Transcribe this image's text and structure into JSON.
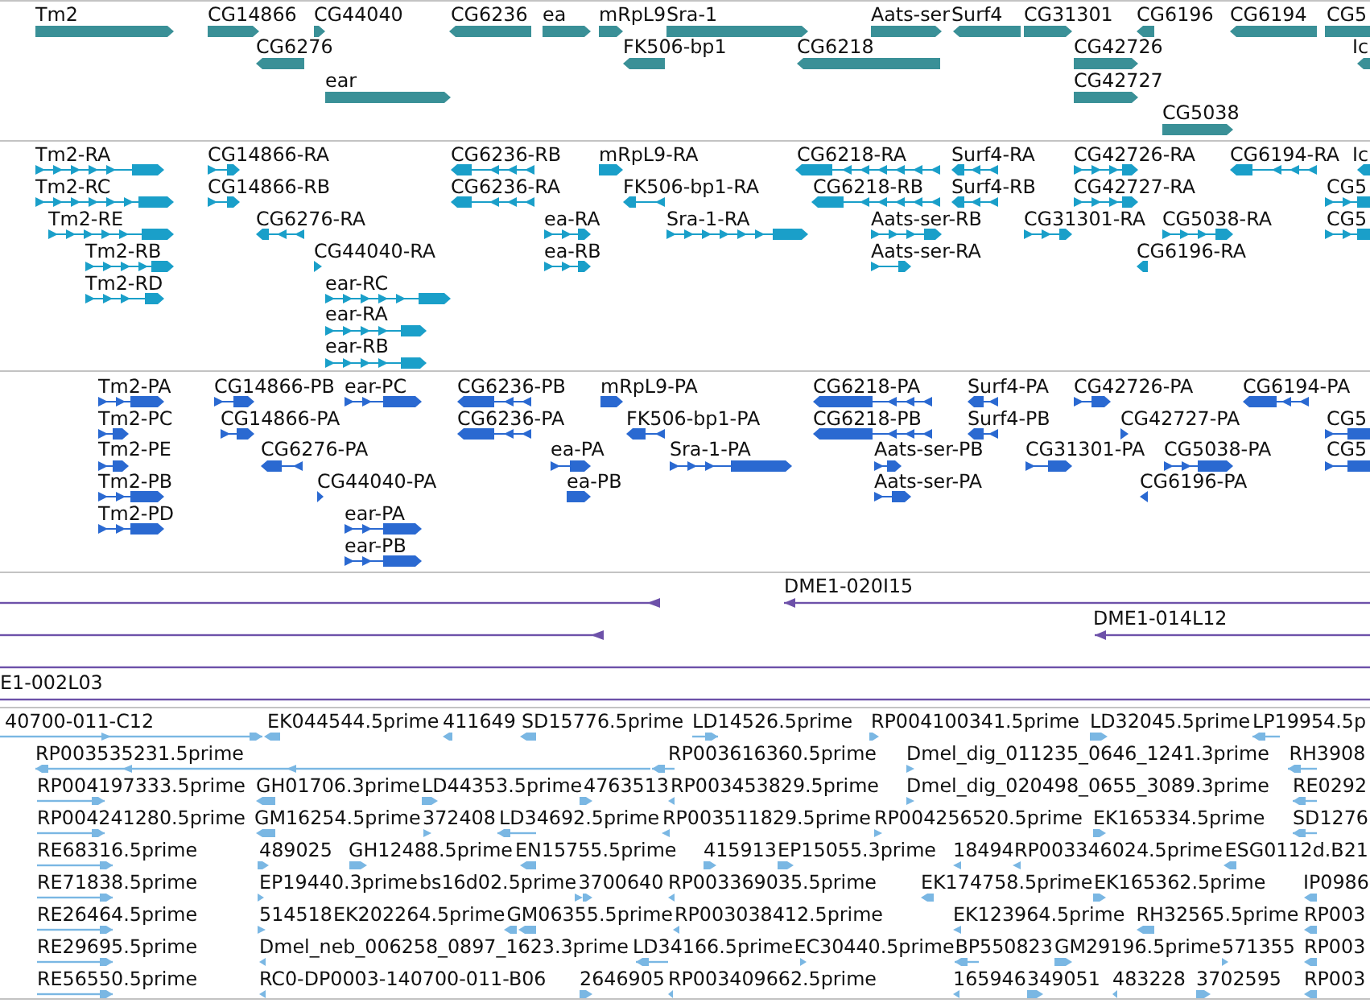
{
  "tracks": [
    {
      "kind": "gene",
      "features": [
        {
          "label": "Tm2",
          "reverse": false
        },
        {
          "label": "CG14866",
          "reverse": false
        },
        {
          "label": "CG44040",
          "reverse": false
        },
        {
          "label": "CG6236",
          "reverse": true
        },
        {
          "label": "ea",
          "reverse": false
        },
        {
          "label": "mRpL9",
          "reverse": false
        },
        {
          "label": "Sra-1",
          "reverse": false
        },
        {
          "label": "Aats-ser",
          "reverse": false
        },
        {
          "label": "Surf4",
          "reverse": true
        },
        {
          "label": "CG31301",
          "reverse": false
        },
        {
          "label": "CG6196",
          "reverse": true
        },
        {
          "label": "CG6194",
          "reverse": true
        },
        {
          "label": "CG5",
          "reverse": false
        },
        {
          "label": "CG6276",
          "reverse": true
        },
        {
          "label": "FK506-bp1",
          "reverse": true
        },
        {
          "label": "CG6218",
          "reverse": true
        },
        {
          "label": "CG42726",
          "reverse": false
        },
        {
          "label": "Ic",
          "reverse": true
        },
        {
          "label": "ear",
          "reverse": false
        },
        {
          "label": "CG42727",
          "reverse": false
        },
        {
          "label": "CG5038",
          "reverse": false
        }
      ]
    },
    {
      "kind": "transcript",
      "features": [
        {
          "label": "Tm2-RA",
          "reverse": false
        },
        {
          "label": "CG14866-RA",
          "reverse": false
        },
        {
          "label": "CG6236-RB",
          "reverse": true
        },
        {
          "label": "mRpL9-RA",
          "reverse": false
        },
        {
          "label": "CG6218-RA",
          "reverse": true
        },
        {
          "label": "Surf4-RA",
          "reverse": true
        },
        {
          "label": "CG42726-RA",
          "reverse": false
        },
        {
          "label": "CG6194-RA",
          "reverse": true
        },
        {
          "label": "Ic",
          "reverse": true
        },
        {
          "label": "Tm2-RC",
          "reverse": false
        },
        {
          "label": "CG14866-RB",
          "reverse": false
        },
        {
          "label": "CG6236-RA",
          "reverse": true
        },
        {
          "label": "FK506-bp1-RA",
          "reverse": true
        },
        {
          "label": "CG6218-RB",
          "reverse": true
        },
        {
          "label": "Surf4-RB",
          "reverse": true
        },
        {
          "label": "CG42727-RA",
          "reverse": false
        },
        {
          "label": "CG5",
          "reverse": false
        },
        {
          "label": "Tm2-RE",
          "reverse": false
        },
        {
          "label": "CG6276-RA",
          "reverse": true
        },
        {
          "label": "ea-RA",
          "reverse": false
        },
        {
          "label": "Sra-1-RA",
          "reverse": false
        },
        {
          "label": "Aats-ser-RB",
          "reverse": false
        },
        {
          "label": "CG31301-RA",
          "reverse": false
        },
        {
          "label": "CG5038-RA",
          "reverse": false
        },
        {
          "label": "CG5",
          "reverse": false
        },
        {
          "label": "Tm2-RB",
          "reverse": false
        },
        {
          "label": "CG44040-RA",
          "reverse": false
        },
        {
          "label": "ea-RB",
          "reverse": false
        },
        {
          "label": "Aats-ser-RA",
          "reverse": false
        },
        {
          "label": "CG6196-RA",
          "reverse": true
        },
        {
          "label": "Tm2-RD",
          "reverse": false
        },
        {
          "label": "ear-RC",
          "reverse": false
        },
        {
          "label": "ear-RA",
          "reverse": false
        },
        {
          "label": "ear-RB",
          "reverse": false
        }
      ]
    },
    {
      "kind": "protein",
      "features": [
        {
          "label": "Tm2-PA",
          "reverse": false
        },
        {
          "label": "CG14866-PB",
          "reverse": false
        },
        {
          "label": "ear-PC",
          "reverse": false
        },
        {
          "label": "CG6236-PB",
          "reverse": true
        },
        {
          "label": "mRpL9-PA",
          "reverse": false
        },
        {
          "label": "CG6218-PA",
          "reverse": true
        },
        {
          "label": "Surf4-PA",
          "reverse": true
        },
        {
          "label": "CG42726-PA",
          "reverse": false
        },
        {
          "label": "CG6194-PA",
          "reverse": true
        },
        {
          "label": "Tm2-PC",
          "reverse": false
        },
        {
          "label": "CG14866-PA",
          "reverse": false
        },
        {
          "label": "CG6236-PA",
          "reverse": true
        },
        {
          "label": "FK506-bp1-PA",
          "reverse": true
        },
        {
          "label": "CG6218-PB",
          "reverse": true
        },
        {
          "label": "Surf4-PB",
          "reverse": true
        },
        {
          "label": "CG42727-PA",
          "reverse": false
        },
        {
          "label": "CG5",
          "reverse": false
        },
        {
          "label": "Tm2-PE",
          "reverse": false
        },
        {
          "label": "CG6276-PA",
          "reverse": true
        },
        {
          "label": "ea-PA",
          "reverse": false
        },
        {
          "label": "Sra-1-PA",
          "reverse": false
        },
        {
          "label": "Aats-ser-PB",
          "reverse": false
        },
        {
          "label": "CG31301-PA",
          "reverse": false
        },
        {
          "label": "CG5038-PA",
          "reverse": false
        },
        {
          "label": "CG5",
          "reverse": false
        },
        {
          "label": "Tm2-PB",
          "reverse": false
        },
        {
          "label": "CG44040-PA",
          "reverse": false
        },
        {
          "label": "ea-PB",
          "reverse": false
        },
        {
          "label": "Aats-ser-PA",
          "reverse": false
        },
        {
          "label": "CG6196-PA",
          "reverse": true
        },
        {
          "label": "Tm2-PD",
          "reverse": false
        },
        {
          "label": "ear-PA",
          "reverse": false
        },
        {
          "label": "ear-PB",
          "reverse": false
        }
      ]
    },
    {
      "kind": "clone",
      "features": [
        {
          "head_at_start": false,
          "head_at_end": true
        },
        {
          "label": "DME1-020I15",
          "head_at_start": true,
          "head_at_end": false
        },
        {
          "head_at_start": false,
          "head_at_end": true
        },
        {
          "label": "DME1-014L12",
          "head_at_start": true,
          "head_at_end": false
        },
        {
          "head_at_start": false,
          "head_at_end": false
        },
        {
          "label": "E1-002L03",
          "head_at_start": false,
          "head_at_end": false
        }
      ]
    },
    {
      "kind": "est",
      "features": [
        {
          "label": "40700-011-C12",
          "reverse": false
        },
        {
          "label": "EK044544.5prime",
          "reverse": true
        },
        {
          "label": "411649",
          "reverse": true
        },
        {
          "label": "SD15776.5prime",
          "reverse": true
        },
        {
          "label": "LD14526.5prime",
          "reverse": false
        },
        {
          "label": "RP004100341.5prime",
          "reverse": false
        },
        {
          "label": "LD32045.5prime",
          "reverse": false
        },
        {
          "label": "LP19954.5p",
          "reverse": true
        },
        {
          "label": "RP003535231.5prime",
          "reverse": true
        },
        {
          "label": "RP003616360.5prime",
          "reverse": true
        },
        {
          "label": "Dmel_dig_011235_0646_1241.3prime",
          "reverse": false
        },
        {
          "label": "RH3908",
          "reverse": true
        },
        {
          "label": "RP004197333.5prime",
          "reverse": false
        },
        {
          "label": "GH01706.3prime",
          "reverse": true
        },
        {
          "label": "LD44353.5prime",
          "reverse": false
        },
        {
          "label": "4763513",
          "reverse": false
        },
        {
          "label": "RP003453829.5prime",
          "reverse": true
        },
        {
          "label": "Dmel_dig_020498_0655_3089.3prime",
          "reverse": false
        },
        {
          "label": "RE0292",
          "reverse": true
        },
        {
          "label": "RP004241280.5prime",
          "reverse": false
        },
        {
          "label": "GM16254.5prime",
          "reverse": true
        },
        {
          "label": "372408",
          "reverse": false
        },
        {
          "label": "LD34692.5prime",
          "reverse": true
        },
        {
          "label": "RP003511829.5prime",
          "reverse": true
        },
        {
          "label": "RP004256520.5prime",
          "reverse": false
        },
        {
          "label": "EK165334.5prime",
          "reverse": false
        },
        {
          "label": "SD1276",
          "reverse": true
        },
        {
          "label": "RE68316.5prime",
          "reverse": false
        },
        {
          "label": "489025",
          "reverse": false
        },
        {
          "label": "GH12488.5prime",
          "reverse": false
        },
        {
          "label": "EN15755.5prime",
          "reverse": true
        },
        {
          "label": "415913",
          "reverse": false
        },
        {
          "label": "EP15055.3prime",
          "reverse": false
        },
        {
          "label": "18494",
          "reverse": true
        },
        {
          "label": "RP003346024.5prime",
          "reverse": true
        },
        {
          "label": "ESG0112d.B21",
          "reverse": true
        },
        {
          "label": "RE71838.5prime",
          "reverse": false
        },
        {
          "label": "EP19440.3prime",
          "reverse": false
        },
        {
          "label": "bs16d02.5prime",
          "reverse": false
        },
        {
          "label": "3700640",
          "reverse": false
        },
        {
          "label": "RP003369035.5prime",
          "reverse": true
        },
        {
          "label": "EK174758.5prime",
          "reverse": true
        },
        {
          "label": "EK165362.5prime",
          "reverse": false
        },
        {
          "label": "IP0986",
          "reverse": true
        },
        {
          "label": "RE26464.5prime",
          "reverse": false
        },
        {
          "label": "514518",
          "reverse": false
        },
        {
          "label": "EK202264.5prime",
          "reverse": true
        },
        {
          "label": "GM06355.5prime",
          "reverse": true
        },
        {
          "label": "RP003038412.5prime",
          "reverse": true
        },
        {
          "label": "EK123964.5prime",
          "reverse": true
        },
        {
          "label": "RH32565.5prime",
          "reverse": true
        },
        {
          "label": "RP003",
          "reverse": true
        },
        {
          "label": "RE29695.5prime",
          "reverse": false
        },
        {
          "label": "Dmel_neb_006258_0897_1623.3prime",
          "reverse": true
        },
        {
          "label": "LD34166.5prime",
          "reverse": true
        },
        {
          "label": "EC30440.5prime",
          "reverse": false
        },
        {
          "label": "BP550823",
          "reverse": true
        },
        {
          "label": "GM29196.5prime",
          "reverse": false
        },
        {
          "label": "571355",
          "reverse": false
        },
        {
          "label": "RP003",
          "reverse": true
        },
        {
          "label": "RE56550.5prime",
          "reverse": false
        },
        {
          "label": "RC0-DP0003-140700-011-B06",
          "reverse": true
        },
        {
          "label": "2646905",
          "reverse": false
        },
        {
          "label": "RP003409662.5prime",
          "reverse": true
        },
        {
          "label": "165946",
          "reverse": true
        },
        {
          "label": "349051",
          "reverse": false
        },
        {
          "label": "483228",
          "reverse": true
        },
        {
          "label": "3702595",
          "reverse": false
        },
        {
          "label": "RP003",
          "reverse": true
        }
      ]
    }
  ]
}
